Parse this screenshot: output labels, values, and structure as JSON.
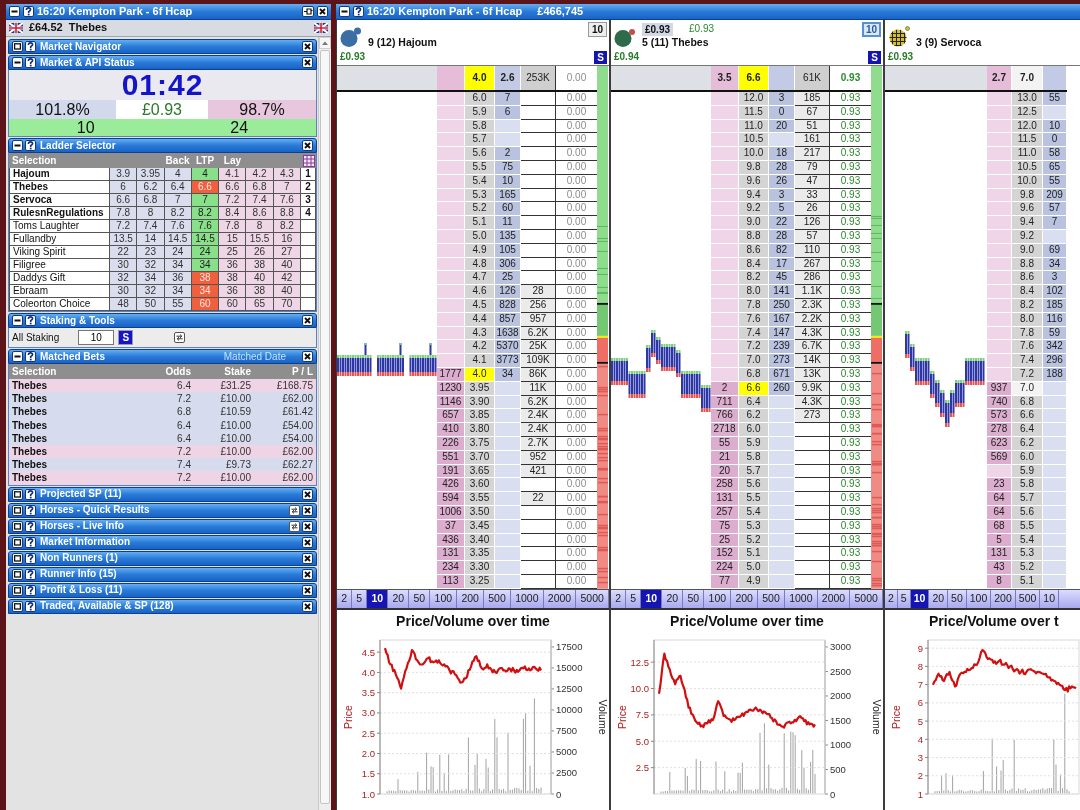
{
  "left_panel": {
    "title": "16:20 Kempton Park - 6f Hcap",
    "balance": "£64.52",
    "selection": "Thebes",
    "sections": [
      {
        "kind": "plain",
        "title": "Market Navigator",
        "expanded": false,
        "refresh_button": false
      },
      {
        "kind": "status",
        "title": "Market & API Status",
        "expanded": true,
        "refresh_button": false,
        "countdown": "01:42",
        "back_book": "101.8%",
        "price": "£0.93",
        "lay_book": "98.7%",
        "counts": [
          "10",
          "24"
        ]
      },
      {
        "kind": "selector",
        "title": "Ladder Selector",
        "expanded": true,
        "refresh_button": false,
        "columns": {
          "selection": "Selection",
          "back": "Back",
          "ltp": "LTP",
          "lay": "Lay"
        },
        "rows": [
          {
            "name": "Hajoum",
            "back": [
              "3.9",
              "3.95",
              "4"
            ],
            "ltp": {
              "text": "4",
              "color": "#88e088"
            },
            "lay": [
              "4.1",
              "4.2",
              "4.3"
            ],
            "ladder": "1"
          },
          {
            "name": "Thebes",
            "back": [
              "6",
              "6.2",
              "6.4"
            ],
            "ltp": {
              "text": "6.6",
              "color": "#f0603c"
            },
            "lay": [
              "6.6",
              "6.8",
              "7"
            ],
            "ladder": "2"
          },
          {
            "name": "Servoca",
            "back": [
              "6.6",
              "6.8",
              "7"
            ],
            "ltp": {
              "text": "7",
              "color": "#88e088"
            },
            "lay": [
              "7.2",
              "7.4",
              "7.6"
            ],
            "ladder": "3"
          },
          {
            "name": "RulesnRegulations",
            "back": [
              "7.8",
              "8",
              "8.2"
            ],
            "ltp": {
              "text": "8.2",
              "color": "#88e088"
            },
            "lay": [
              "8.4",
              "8.6",
              "8.8"
            ],
            "ladder": "4"
          },
          {
            "name": "Toms Laughter",
            "back": [
              "7.2",
              "7.4",
              "7.6"
            ],
            "ltp": {
              "text": "7.6",
              "color": "#88e088"
            },
            "lay": [
              "7.8",
              "8",
              "8.2"
            ]
          },
          {
            "name": "Fullandby",
            "back": [
              "13.5",
              "14",
              "14.5"
            ],
            "ltp": {
              "text": "14.5",
              "color": "#88e088"
            },
            "lay": [
              "15",
              "15.5",
              "16"
            ]
          },
          {
            "name": "Viking Spirit",
            "back": [
              "22",
              "23",
              "24"
            ],
            "ltp": {
              "text": "24",
              "color": "#88e088"
            },
            "lay": [
              "25",
              "26",
              "27"
            ]
          },
          {
            "name": "Filigree",
            "back": [
              "30",
              "32",
              "34"
            ],
            "ltp": {
              "text": "34",
              "color": "#88e088"
            },
            "lay": [
              "36",
              "38",
              "40"
            ]
          },
          {
            "name": "Daddys Gift",
            "back": [
              "32",
              "34",
              "36"
            ],
            "ltp": {
              "text": "38",
              "color": "#f0603c"
            },
            "lay": [
              "38",
              "40",
              "42"
            ]
          },
          {
            "name": "Ebraam",
            "back": [
              "30",
              "32",
              "34"
            ],
            "ltp": {
              "text": "34",
              "color": "#f0603c"
            },
            "lay": [
              "36",
              "38",
              "40"
            ]
          },
          {
            "name": "Coleorton Choice",
            "back": [
              "48",
              "50",
              "55"
            ],
            "ltp": {
              "text": "60",
              "color": "#f0603c"
            },
            "lay": [
              "60",
              "65",
              "70"
            ]
          }
        ]
      },
      {
        "kind": "staking",
        "title": "Staking & Tools",
        "expanded": true,
        "refresh_button": false,
        "label": "All Staking",
        "stake": "10",
        "button": "S"
      },
      {
        "kind": "bets",
        "title": "Matched Bets",
        "expanded": true,
        "refresh_button": false,
        "sort_label": "Matched Date",
        "columns": [
          "Selection",
          "Odds",
          "Stake",
          "P / L"
        ],
        "rows": [
          {
            "kind": "lay",
            "selection": "Thebes",
            "odds": "6.4",
            "stake": "£31.25",
            "pl": "£168.75"
          },
          {
            "kind": "back",
            "selection": "Thebes",
            "odds": "7.2",
            "stake": "£10.00",
            "pl": "£62.00"
          },
          {
            "kind": "back",
            "selection": "Thebes",
            "odds": "6.8",
            "stake": "£10.59",
            "pl": "£61.42"
          },
          {
            "kind": "back",
            "selection": "Thebes",
            "odds": "6.4",
            "stake": "£10.00",
            "pl": "£54.00"
          },
          {
            "kind": "back",
            "selection": "Thebes",
            "odds": "6.4",
            "stake": "£10.00",
            "pl": "£54.00"
          },
          {
            "kind": "lay",
            "selection": "Thebes",
            "odds": "7.2",
            "stake": "£10.00",
            "pl": "£62.00"
          },
          {
            "kind": "back",
            "selection": "Thebes",
            "odds": "7.4",
            "stake": "£9.73",
            "pl": "£62.27"
          },
          {
            "kind": "lay",
            "selection": "Thebes",
            "odds": "7.2",
            "stake": "£10.00",
            "pl": "£62.00"
          }
        ]
      },
      {
        "kind": "plain",
        "title": "Projected SP (11)",
        "expanded": false,
        "refresh_button": false
      },
      {
        "kind": "plain",
        "title": "Horses - Quick Results",
        "expanded": false,
        "refresh_button": true
      },
      {
        "kind": "plain",
        "title": "Horses - Live Info",
        "expanded": false,
        "refresh_button": true
      },
      {
        "kind": "plain",
        "title": "Market Information",
        "expanded": false,
        "refresh_button": false
      },
      {
        "kind": "plain",
        "title": "Non Runners (1)",
        "expanded": false,
        "refresh_button": false
      },
      {
        "kind": "plain",
        "title": "Runner Info (15)",
        "expanded": false,
        "refresh_button": false
      },
      {
        "kind": "plain",
        "title": "Profit & Loss (11)",
        "expanded": false,
        "refresh_button": false
      },
      {
        "kind": "plain",
        "title": "Traded, Available & SP (128)",
        "expanded": false,
        "refresh_button": false
      }
    ]
  },
  "ladder_window": {
    "title": "16:20 Kempton Park - 6f Hcap",
    "matched": "£466,745"
  },
  "ladders": [
    {
      "silk": {
        "kind": "plain",
        "color": "#3a6ea5"
      },
      "runner": "9 (12) Hajoum",
      "profit": "£0.93",
      "multiplier": "10",
      "multiplier_active": false,
      "stake_button": "S",
      "pl_positive": false,
      "ltp_highlight": true,
      "depth_bar": true,
      "top": {
        "price": "4.0",
        "back": "2.6",
        "traded": "253K",
        "pl": "0.00"
      },
      "above": [
        {
          "price": "6.0",
          "back": "7",
          "pl": "0.00"
        },
        {
          "price": "5.9",
          "back": "6",
          "pl": "0.00"
        },
        {
          "price": "5.8",
          "pl": "0.00"
        },
        {
          "price": "5.7",
          "pl": "0.00"
        },
        {
          "price": "5.6",
          "back": "2",
          "pl": "0.00"
        },
        {
          "price": "5.5",
          "back": "75",
          "pl": "0.00"
        },
        {
          "price": "5.4",
          "back": "10",
          "pl": "0.00"
        },
        {
          "price": "5.3",
          "back": "165",
          "pl": "0.00"
        },
        {
          "price": "5.2",
          "back": "60",
          "pl": "0.00"
        },
        {
          "price": "5.1",
          "back": "11",
          "pl": "0.00"
        },
        {
          "price": "5.0",
          "back": "135",
          "pl": "0.00"
        },
        {
          "price": "4.9",
          "back": "105",
          "pl": "0.00"
        },
        {
          "price": "4.8",
          "back": "306",
          "pl": "0.00"
        },
        {
          "price": "4.7",
          "back": "25",
          "pl": "0.00"
        },
        {
          "price": "4.6",
          "back": "126",
          "traded": "28",
          "pl": "0.00"
        },
        {
          "price": "4.5",
          "back": "828",
          "traded": "256",
          "pl": "0.00"
        },
        {
          "price": "4.4",
          "back": "857",
          "traded": "957",
          "pl": "0.00"
        },
        {
          "price": "4.3",
          "back": "1638",
          "traded": "6.2K",
          "pl": "0.00"
        },
        {
          "price": "4.2",
          "back": "5370",
          "traded": "25K",
          "pl": "0.00"
        },
        {
          "price": "4.1",
          "back": "3773",
          "traded": "109K",
          "pl": "0.00"
        }
      ],
      "current": {
        "lay": "1777",
        "price": "4.0",
        "back": "34",
        "traded": "86K",
        "pl": "0.00"
      },
      "below": [
        {
          "lay": "1230",
          "price": "3.95",
          "traded": "11K",
          "pl": "0.00"
        },
        {
          "lay": "1146",
          "price": "3.90",
          "traded": "6.2K",
          "pl": "0.00"
        },
        {
          "lay": "657",
          "price": "3.85",
          "traded": "2.4K",
          "pl": "0.00"
        },
        {
          "lay": "410",
          "price": "3.80",
          "traded": "2.4K",
          "pl": "0.00"
        },
        {
          "lay": "226",
          "price": "3.75",
          "traded": "2.7K",
          "pl": "0.00"
        },
        {
          "lay": "551",
          "price": "3.70",
          "traded": "952",
          "pl": "0.00"
        },
        {
          "lay": "191",
          "price": "3.65",
          "traded": "421",
          "pl": "0.00"
        },
        {
          "lay": "426",
          "price": "3.60",
          "pl": "0.00"
        },
        {
          "lay": "594",
          "price": "3.55",
          "traded": "22",
          "pl": "0.00"
        },
        {
          "lay": "1006",
          "price": "3.50",
          "pl": "0.00"
        },
        {
          "lay": "37",
          "price": "3.45",
          "pl": "0.00"
        },
        {
          "lay": "436",
          "price": "3.40",
          "pl": "0.00"
        },
        {
          "lay": "131",
          "price": "3.35",
          "pl": "0.00"
        },
        {
          "lay": "234",
          "price": "3.30",
          "pl": "0.00"
        },
        {
          "lay": "113",
          "price": "3.25",
          "pl": "0.00"
        }
      ],
      "stakes": [
        {
          "label": "2",
          "selected": false
        },
        {
          "label": "5",
          "selected": false
        },
        {
          "label": "10",
          "selected": true
        },
        {
          "label": "20",
          "selected": false
        },
        {
          "label": "50",
          "selected": false
        },
        {
          "label": "100",
          "selected": false
        },
        {
          "label": "200",
          "selected": false
        },
        {
          "label": "500",
          "selected": false
        },
        {
          "label": "1000",
          "selected": false
        },
        {
          "label": "2000",
          "selected": false
        },
        {
          "label": "5000",
          "selected": false
        }
      ],
      "chart": {
        "chart_data": {
          "type": "line",
          "title": "Price/Volume over time",
          "ylabel": "Price",
          "ylim": [
            1.0,
            4.8
          ],
          "yticks": [
            {
              "value": 1,
              "label": "1.0"
            },
            {
              "value": 1.5,
              "label": "1.5"
            },
            {
              "value": 2,
              "label": "2.0"
            },
            {
              "value": 2.5,
              "label": "2.5"
            },
            {
              "value": 3,
              "label": "3.0"
            },
            {
              "value": 3.5,
              "label": "3.5"
            },
            {
              "value": 4,
              "label": "4.0"
            },
            {
              "value": 4.5,
              "label": "4.5"
            }
          ],
          "grid": true,
          "values": [
            4.6,
            4.2,
            3.95,
            3.6,
            4.1,
            4.55,
            4.3,
            4.2,
            4.35,
            4.25,
            4.3,
            4.2,
            4.05,
            3.95,
            3.75,
            3.85,
            4.15,
            4.4,
            4.1,
            4.2,
            4.0,
            4.05,
            4.05,
            4.1,
            4.05,
            4.05,
            4.15,
            4.05,
            4.1,
            4.05
          ]
        },
        "volume_axis": {
          "label": "Volume",
          "ticks": [
            "17500",
            "15000",
            "12500",
            "10000",
            "7500",
            "5000",
            "2500",
            "0"
          ]
        }
      }
    },
    {
      "silk": {
        "kind": "spotted",
        "color": "#2e6b4a"
      },
      "top_values": [
        "£0.93",
        "£0.93"
      ],
      "runner": "5 (11) Thebes",
      "profit": "£0.94",
      "multiplier": "10",
      "multiplier_active": true,
      "stake_button": "S",
      "pl_positive": true,
      "ltp_highlight": true,
      "depth_bar": true,
      "top": {
        "lay": "3.5",
        "price": "6.6",
        "traded": "61K",
        "pl": "0.93"
      },
      "above": [
        {
          "price": "12.0",
          "back": "3",
          "traded": "185",
          "pl": "0.93"
        },
        {
          "price": "11.5",
          "back": "0",
          "traded": "67",
          "pl": "0.93"
        },
        {
          "price": "11.0",
          "back": "20",
          "traded": "51",
          "pl": "0.93"
        },
        {
          "price": "10.5",
          "traded": "161",
          "pl": "0.93"
        },
        {
          "price": "10.0",
          "back": "18",
          "traded": "217",
          "pl": "0.93"
        },
        {
          "price": "9.8",
          "back": "28",
          "traded": "79",
          "pl": "0.93"
        },
        {
          "price": "9.6",
          "back": "26",
          "traded": "47",
          "pl": "0.93"
        },
        {
          "price": "9.4",
          "back": "3",
          "traded": "33",
          "pl": "0.93"
        },
        {
          "price": "9.2",
          "back": "5",
          "traded": "26",
          "pl": "0.93"
        },
        {
          "price": "9.0",
          "back": "22",
          "traded": "126",
          "pl": "0.93"
        },
        {
          "price": "8.8",
          "back": "28",
          "traded": "57",
          "pl": "0.93"
        },
        {
          "price": "8.6",
          "back": "82",
          "traded": "110",
          "pl": "0.93"
        },
        {
          "price": "8.4",
          "back": "17",
          "traded": "267",
          "pl": "0.93"
        },
        {
          "price": "8.2",
          "back": "45",
          "traded": "286",
          "pl": "0.93"
        },
        {
          "price": "8.0",
          "back": "141",
          "traded": "1.1K",
          "pl": "0.93"
        },
        {
          "price": "7.8",
          "back": "250",
          "traded": "2.3K",
          "pl": "0.93"
        },
        {
          "price": "7.6",
          "back": "167",
          "traded": "2.2K",
          "pl": "0.93"
        },
        {
          "price": "7.4",
          "back": "147",
          "traded": "4.3K",
          "pl": "0.93"
        },
        {
          "price": "7.2",
          "back": "239",
          "traded": "6.7K",
          "pl": "0.93"
        },
        {
          "price": "7.0",
          "back": "273",
          "traded": "14K",
          "pl": "0.93"
        },
        {
          "price": "6.8",
          "back": "671",
          "traded": "13K",
          "pl": "0.93"
        }
      ],
      "current": {
        "lay": "2",
        "price": "6.6",
        "back": "260",
        "traded": "9.9K",
        "pl": "0.93"
      },
      "below": [
        {
          "lay": "711",
          "price": "6.4",
          "traded": "4.3K",
          "pl": "0.93"
        },
        {
          "lay": "766",
          "price": "6.2",
          "traded": "273",
          "pl": "0.93"
        },
        {
          "lay": "2718",
          "price": "6.0",
          "pl": "0.93"
        },
        {
          "lay": "55",
          "price": "5.9",
          "pl": "0.93"
        },
        {
          "lay": "21",
          "price": "5.8",
          "pl": "0.93"
        },
        {
          "lay": "20",
          "price": "5.7",
          "pl": "0.93"
        },
        {
          "lay": "258",
          "price": "5.6",
          "pl": "0.93"
        },
        {
          "lay": "131",
          "price": "5.5",
          "pl": "0.93"
        },
        {
          "lay": "257",
          "price": "5.4",
          "pl": "0.93"
        },
        {
          "lay": "75",
          "price": "5.3",
          "pl": "0.93"
        },
        {
          "lay": "25",
          "price": "5.2",
          "pl": "0.93"
        },
        {
          "lay": "152",
          "price": "5.1",
          "pl": "0.93"
        },
        {
          "lay": "224",
          "price": "5.0",
          "pl": "0.93"
        },
        {
          "lay": "77",
          "price": "4.9",
          "pl": "0.93"
        }
      ],
      "stakes": [
        {
          "label": "2",
          "selected": false
        },
        {
          "label": "5",
          "selected": false
        },
        {
          "label": "10",
          "selected": true
        },
        {
          "label": "20",
          "selected": false
        },
        {
          "label": "50",
          "selected": false
        },
        {
          "label": "100",
          "selected": false
        },
        {
          "label": "200",
          "selected": false
        },
        {
          "label": "500",
          "selected": false
        },
        {
          "label": "1000",
          "selected": false
        },
        {
          "label": "2000",
          "selected": false
        },
        {
          "label": "5000",
          "selected": false
        }
      ],
      "chart": {
        "chart_data": {
          "type": "line",
          "title": "Price/Volume over time",
          "ylabel": "Price",
          "ylim": [
            0,
            14.6
          ],
          "yticks": [
            {
              "value": 2.5,
              "label": "2.5"
            },
            {
              "value": 5,
              "label": "5.0"
            },
            {
              "value": 7.5,
              "label": "7.5"
            },
            {
              "value": 10,
              "label": "10.0"
            },
            {
              "value": 12.5,
              "label": "12.5"
            }
          ],
          "grid": true,
          "values": [
            9.5,
            13.3,
            11.8,
            10.4,
            11.2,
            9.2,
            7.6,
            6.8,
            6.5,
            6.7,
            7.0,
            8.8,
            7.4,
            7.1,
            7.0,
            7.3,
            7.7,
            8.0,
            8.2,
            7.9,
            7.6,
            7.2,
            6.6,
            6.4,
            6.8,
            6.8,
            7.3,
            6.9,
            6.6,
            6.6
          ]
        },
        "volume_axis": {
          "label": "Volume",
          "ticks": [
            "3000",
            "2500",
            "2000",
            "1500",
            "1000",
            "500",
            "0"
          ]
        }
      }
    },
    {
      "silk": {
        "kind": "checked",
        "color": "#d6c020"
      },
      "runner": "3 (9) Servoca",
      "profit": "£0.93",
      "ltp_highlight": false,
      "top": {
        "lay": "2.7",
        "price": "7.0"
      },
      "above": [
        {
          "price": "13.0",
          "back": "55"
        },
        {
          "price": "12.5"
        },
        {
          "price": "12.0",
          "back": "10"
        },
        {
          "price": "11.5",
          "back": "0"
        },
        {
          "price": "11.0",
          "back": "58"
        },
        {
          "price": "10.5",
          "back": "65"
        },
        {
          "price": "10.0",
          "back": "55"
        },
        {
          "price": "9.8",
          "back": "209"
        },
        {
          "price": "9.6",
          "back": "57"
        },
        {
          "price": "9.4",
          "back": "7"
        },
        {
          "price": "9.2"
        },
        {
          "price": "9.0",
          "back": "69"
        },
        {
          "price": "8.8",
          "back": "34"
        },
        {
          "price": "8.6",
          "back": "3"
        },
        {
          "price": "8.4",
          "back": "102"
        },
        {
          "price": "8.2",
          "back": "185"
        },
        {
          "price": "8.0",
          "back": "116"
        },
        {
          "price": "7.8",
          "back": "59"
        },
        {
          "price": "7.6",
          "back": "342"
        },
        {
          "price": "7.4",
          "back": "296"
        },
        {
          "price": "7.2",
          "back": "188"
        }
      ],
      "current": {
        "lay": "937",
        "price": "7.0"
      },
      "below": [
        {
          "lay": "740",
          "price": "6.8"
        },
        {
          "lay": "573",
          "price": "6.6"
        },
        {
          "lay": "278",
          "price": "6.4"
        },
        {
          "lay": "623",
          "price": "6.2"
        },
        {
          "lay": "569",
          "price": "6.0"
        },
        {
          "price": "5.9"
        },
        {
          "lay": "23",
          "price": "5.8"
        },
        {
          "lay": "64",
          "price": "5.7"
        },
        {
          "lay": "64",
          "price": "5.6"
        },
        {
          "lay": "68",
          "price": "5.5"
        },
        {
          "lay": "5",
          "price": "5.4"
        },
        {
          "lay": "131",
          "price": "5.3"
        },
        {
          "lay": "43",
          "price": "5.2"
        },
        {
          "lay": "8",
          "price": "5.1"
        }
      ],
      "stakes": [
        {
          "label": "2",
          "selected": false
        },
        {
          "label": "5",
          "selected": false
        },
        {
          "label": "10",
          "selected": true
        },
        {
          "label": "20",
          "selected": false
        },
        {
          "label": "50",
          "selected": false
        },
        {
          "label": "100",
          "selected": false
        },
        {
          "label": "200",
          "selected": false
        },
        {
          "label": "500",
          "selected": false
        },
        {
          "label": "10",
          "selected": false
        }
      ],
      "chart": {
        "chart_data": {
          "type": "line",
          "title": "Price/Volume over t",
          "ylabel": "Price",
          "ylim": [
            1,
            9.45
          ],
          "yticks": [
            1,
            2,
            3,
            4,
            5,
            6,
            7,
            8,
            9
          ],
          "grid": true,
          "values": [
            7.0,
            7.6,
            7.2,
            7.7,
            6.9,
            7.6,
            7.7,
            7.9,
            8.1,
            8.9,
            8.4,
            8.2,
            8.3,
            8.1,
            8.0,
            7.8,
            7.7,
            7.7,
            7.8,
            7.7,
            7.6,
            7.4,
            7.2,
            7.0,
            6.7,
            6.8,
            6.8
          ]
        }
      }
    }
  ]
}
